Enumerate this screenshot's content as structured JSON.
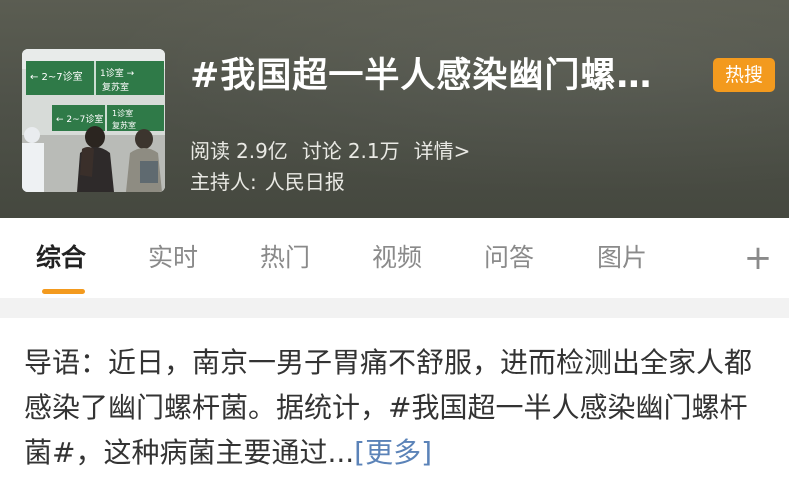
{
  "topic": {
    "title": "#我国超一半人感染幽门螺…",
    "hot_badge": "热搜",
    "stats": {
      "read_label": "阅读",
      "read_value": "2.9亿",
      "discuss_label": "讨论",
      "discuss_value": "2.1万",
      "detail_link": "详情>"
    },
    "host_label": "主持人:",
    "host_name": "人民日报",
    "cover_sign_texts": [
      "← 2~7诊室",
      "1诊室 →",
      "复苏室",
      "← 2~7诊室",
      "1诊室",
      "复苏室"
    ]
  },
  "tabs": {
    "items": [
      "综合",
      "实时",
      "热门",
      "视频",
      "问答",
      "图片"
    ],
    "active_index": 0,
    "add_label": "+"
  },
  "intro": {
    "text": "导语：近日，南京一男子胃痛不舒服，进而检测出全家人都感染了幽门螺杆菌。据统计，#我国超一半人感染幽门螺杆菌#，这种病菌主要通过...",
    "more_label": "[更多]"
  },
  "colors": {
    "accent": "#f39a1e",
    "header_bg": "#4f5249",
    "link": "#5b83b8"
  },
  "icons": {
    "plus": "plus-icon",
    "detail": "chevron-right-icon"
  }
}
